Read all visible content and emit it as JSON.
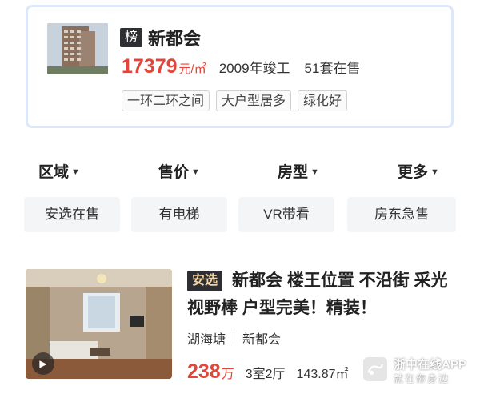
{
  "community": {
    "rank_badge": "榜",
    "name": "新都会",
    "price": "17379",
    "price_unit": "元/㎡",
    "built_year": "2009年竣工",
    "on_sale": "51套在售",
    "tags": [
      "一环二环之间",
      "大户型居多",
      "绿化好"
    ],
    "photo_icon": "building-photo"
  },
  "filters": [
    {
      "label": "区域",
      "icon": "chevron-down-icon"
    },
    {
      "label": "售价",
      "icon": "chevron-down-icon"
    },
    {
      "label": "房型",
      "icon": "chevron-down-icon"
    },
    {
      "label": "更多",
      "icon": "chevron-down-icon"
    }
  ],
  "quick_filters": [
    "安选在售",
    "有电梯",
    "VR带看",
    "房东急售"
  ],
  "listing": {
    "badge": "安选",
    "title": "新都会 楼王位置 不沿街 采光视野棒 户型完美！精装！",
    "district": "湖海塘",
    "community": "新都会",
    "price": "238",
    "price_unit": "万",
    "layout": "3室2厅",
    "area": "143.87㎡",
    "play_icon": "play-icon"
  },
  "watermark": {
    "name": "浙中在线APP",
    "slogan": "就在你身边"
  },
  "colors": {
    "accent_red": "#e2463a",
    "card_border": "#dde8fb",
    "badge_dark": "#2e2f33"
  }
}
